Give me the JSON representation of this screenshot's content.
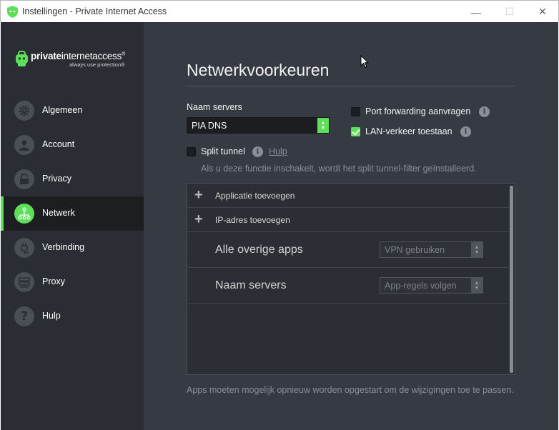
{
  "window": {
    "title": "Instellingen - Private Internet Access",
    "controls": {
      "minimize": "—",
      "maximize": "☐",
      "close": "✕"
    }
  },
  "logo": {
    "name_bold": "private",
    "name_regular": "internetaccess",
    "registered": "®",
    "tagline": "always use protection®"
  },
  "sidebar": {
    "items": [
      {
        "label": "Algemeen",
        "icon": "gear-icon",
        "active": false
      },
      {
        "label": "Account",
        "icon": "person-icon",
        "active": false
      },
      {
        "label": "Privacy",
        "icon": "lock-icon",
        "active": false
      },
      {
        "label": "Netwerk",
        "icon": "network-icon",
        "active": true
      },
      {
        "label": "Verbinding",
        "icon": "plug-icon",
        "active": false
      },
      {
        "label": "Proxy",
        "icon": "server-icon",
        "active": false
      },
      {
        "label": "Hulp",
        "icon": "question-icon",
        "active": false
      }
    ]
  },
  "main": {
    "title": "Netwerkvoorkeuren",
    "name_servers": {
      "label": "Naam servers",
      "value": "PIA DNS"
    },
    "port_forwarding": {
      "label": "Port forwarding aanvragen",
      "checked": false
    },
    "lan_traffic": {
      "label": "LAN-verkeer toestaan",
      "checked": true
    },
    "split_tunnel": {
      "label": "Split tunnel",
      "checked": false,
      "help_link": "Hulp",
      "description": "Als u deze functie inschakelt, wordt het split tunnel-filter geïnstalleerd.",
      "add_app": "Applicatie toevoegen",
      "add_ip": "IP-adres toevoegen",
      "rules": [
        {
          "label": "Alle overige apps",
          "value": "VPN gebruiken"
        },
        {
          "label": "Naam servers",
          "value": "App-regels volgen"
        }
      ]
    },
    "footer_note": "Apps moeten mogelijk opnieuw worden opgestart om de wijzigingen toe te passen."
  },
  "colors": {
    "accent": "#5ddf5a",
    "sidebar_bg": "#2a2d33",
    "main_bg": "#363a42",
    "active_bg": "#1c1e22"
  }
}
